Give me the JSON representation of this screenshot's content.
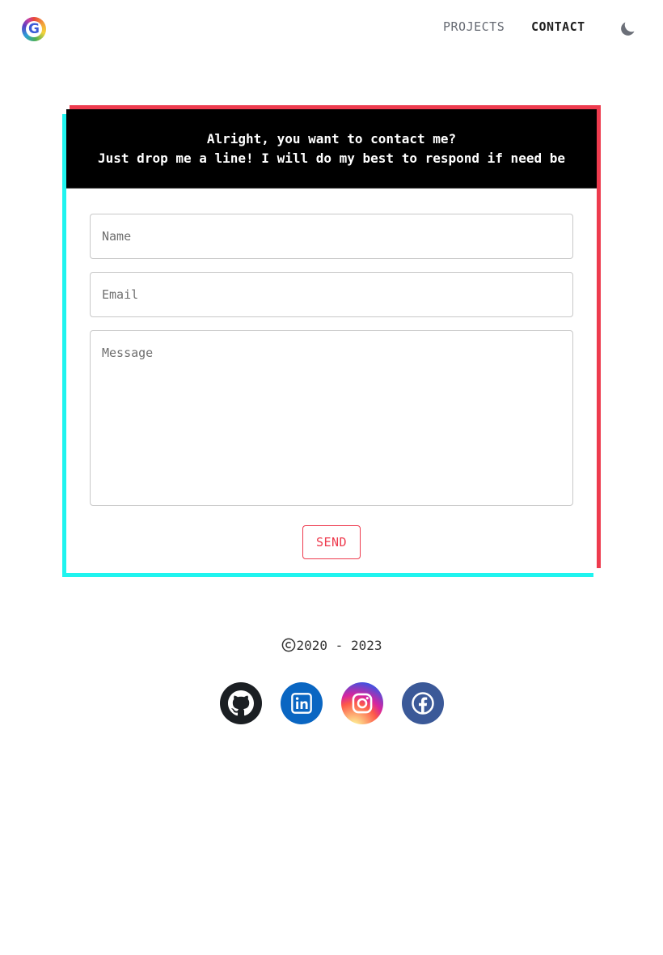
{
  "header": {
    "logo_letter": "G",
    "nav": {
      "projects": "PROJECTS",
      "contact": "CONTACT"
    },
    "theme_toggle_icon": "moon-icon"
  },
  "contact_card": {
    "heading_line1": "Alright, you want to contact me?",
    "heading_line2": "Just drop me a line! I will do my best to respond if need be",
    "name_placeholder": "Name",
    "email_placeholder": "Email",
    "message_placeholder": "Message",
    "send_label": "SEND"
  },
  "footer": {
    "copyright_years": "2020 - 2023",
    "social": [
      "github-icon",
      "linkedin-icon",
      "instagram-icon",
      "facebook-icon"
    ]
  },
  "colors": {
    "accent_red": "#ee3b4e",
    "accent_cyan": "#1ff4ef",
    "header_bg": "#000000"
  }
}
